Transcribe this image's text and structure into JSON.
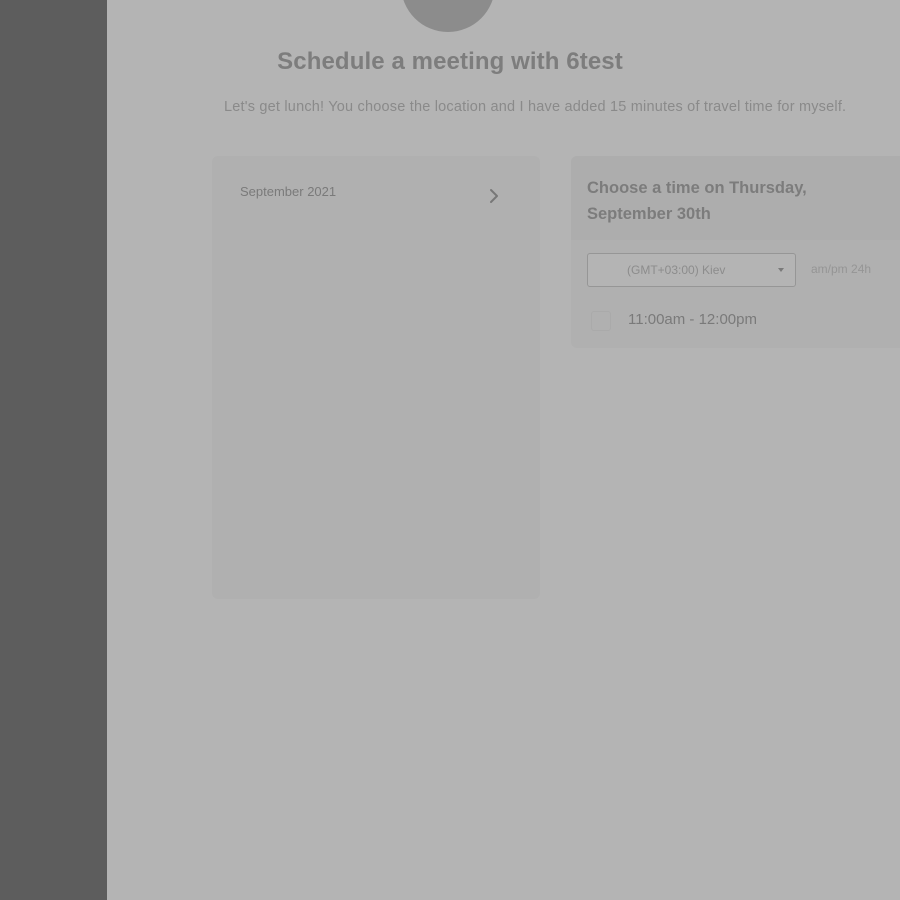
{
  "header": {
    "title": "Schedule a meeting with 6test",
    "subtitle": "Let's get lunch! You choose the location and I have added 15 minutes of travel time for myself."
  },
  "calendar": {
    "month_label": "September 2021",
    "next_icon": "chevron-right-icon"
  },
  "time_picker": {
    "title": "Choose a time on Thursday, September 30th",
    "timezone": {
      "selected": "(GMT+03:00) Kiev"
    },
    "format": {
      "ampm_label": "am/pm",
      "h24_label": "24h"
    },
    "slots": [
      {
        "label": "11:00am - 12:00pm"
      }
    ]
  },
  "colors": {
    "overlay": "#b4b4b4",
    "sidebar": "#5d5d5d",
    "text_heading": "#7d7d7d"
  }
}
